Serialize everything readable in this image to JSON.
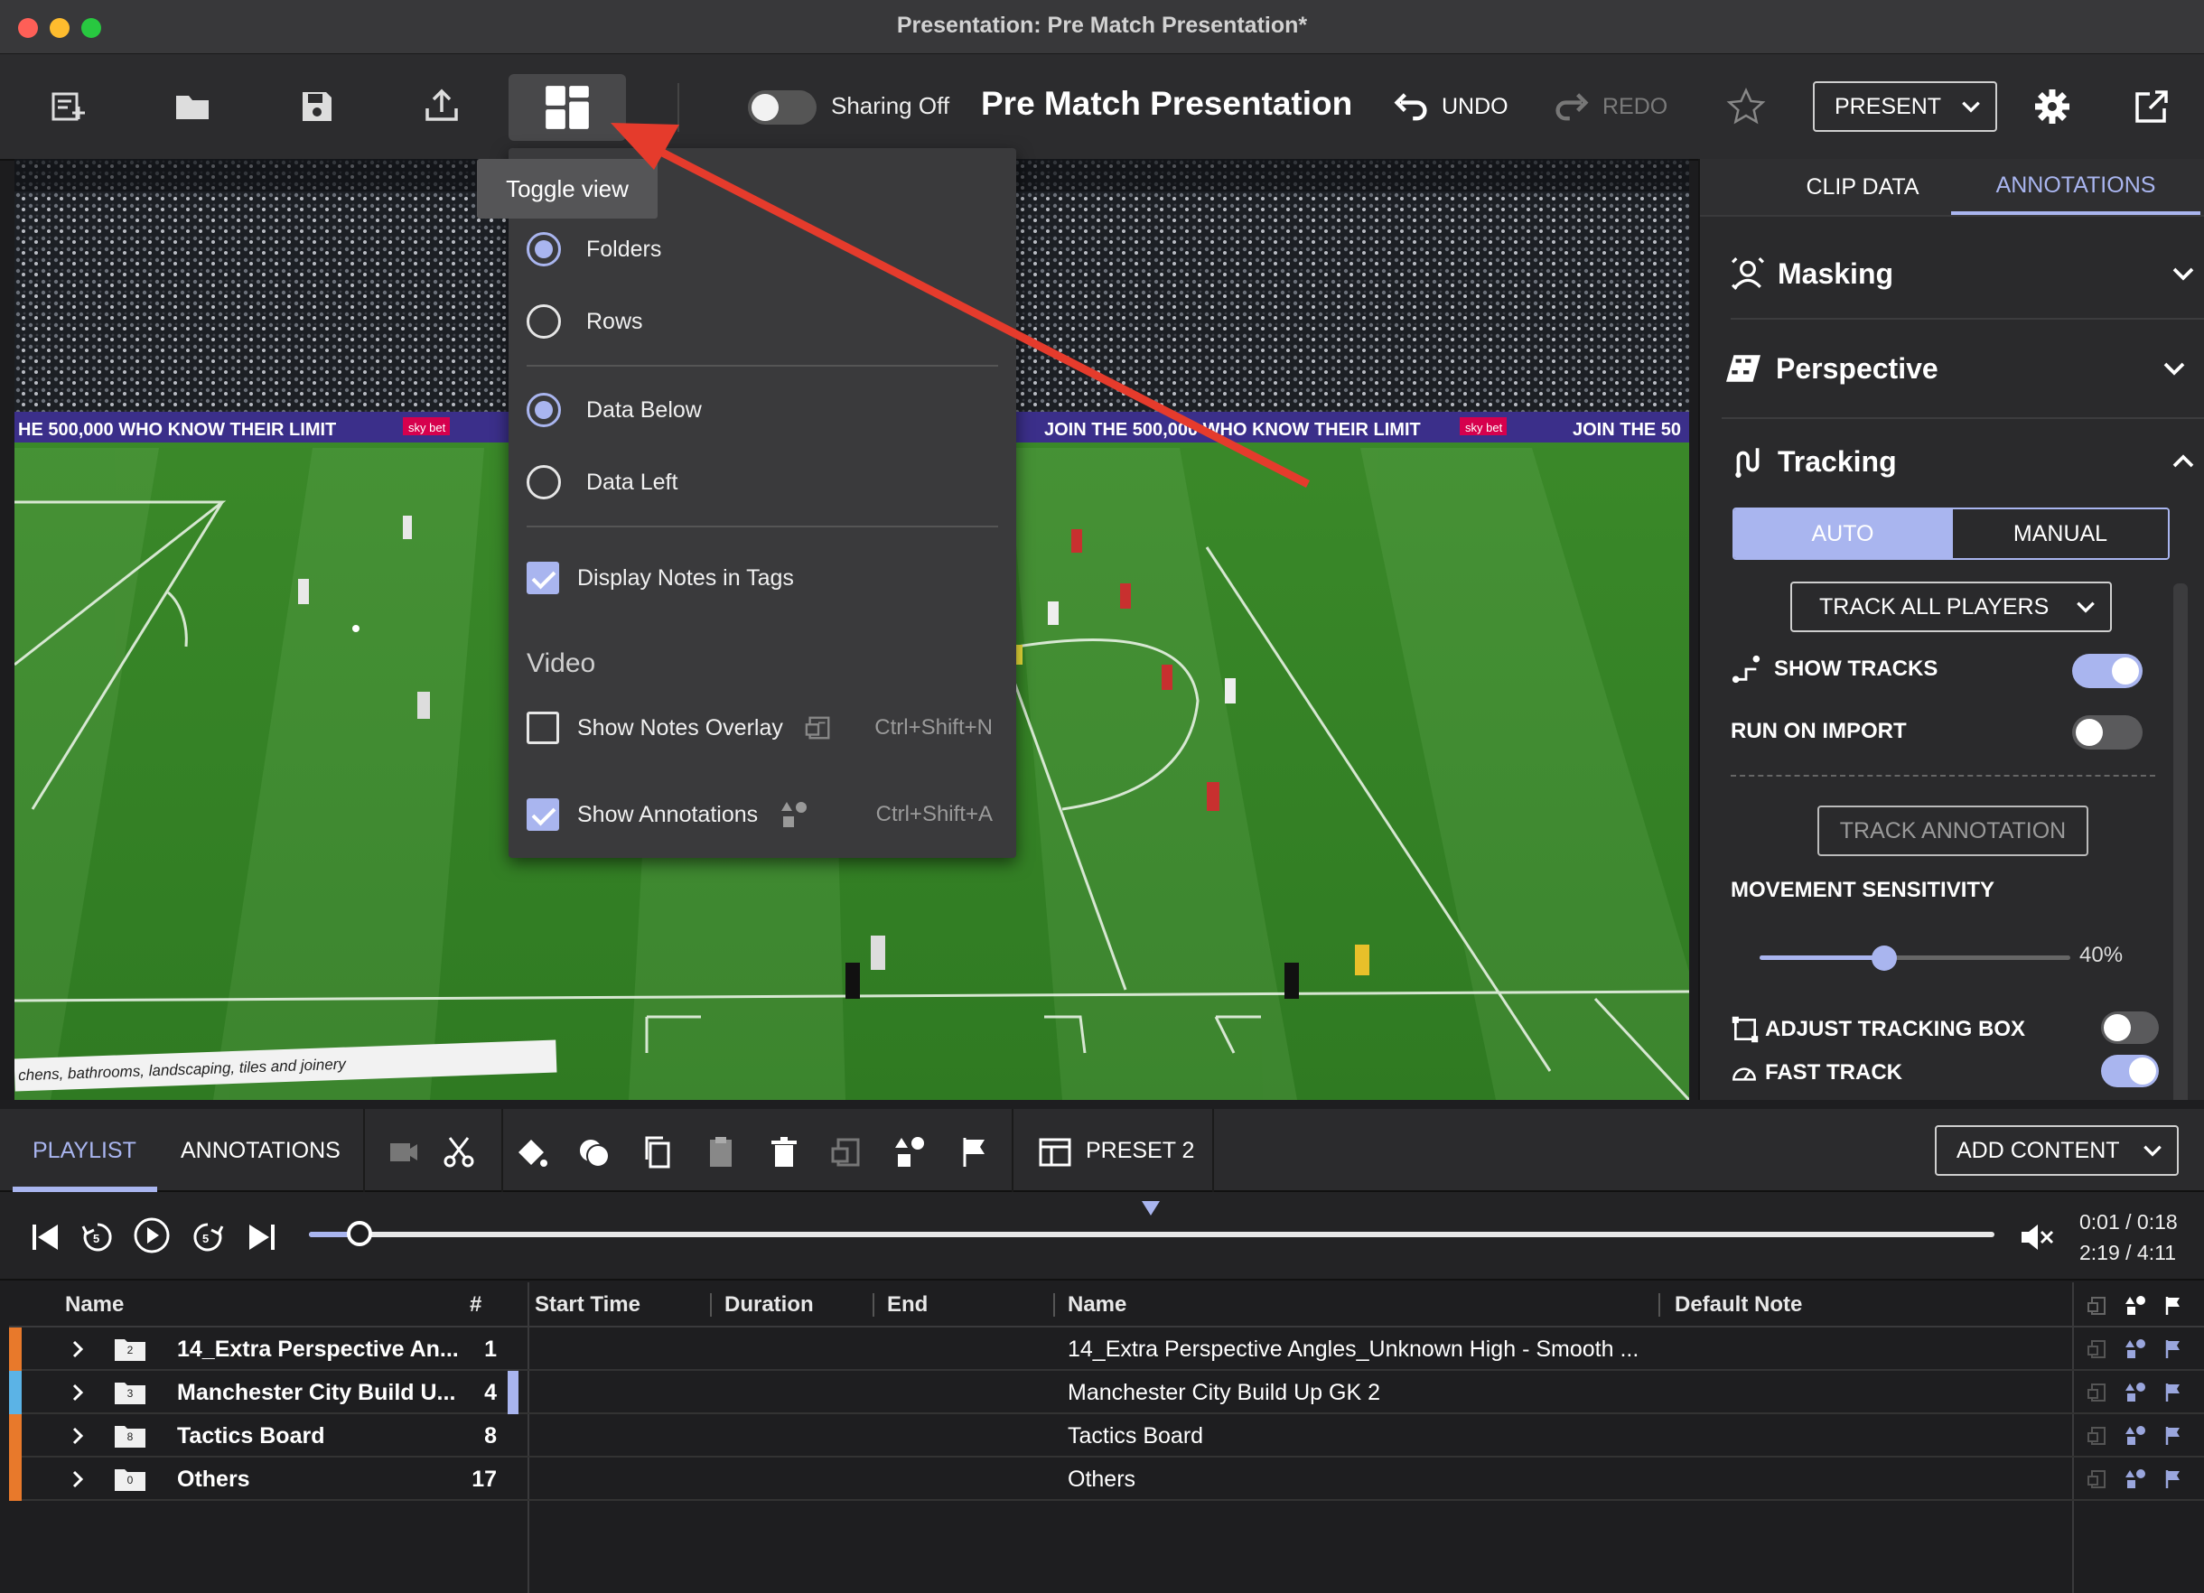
{
  "window": {
    "title": "Presentation: Pre Match Presentation*"
  },
  "toolbar": {
    "sharing_label": "Sharing Off",
    "presentation_title": "Pre Match Presentation",
    "undo_label": "UNDO",
    "redo_label": "REDO",
    "present_label": "PRESENT"
  },
  "tooltip": {
    "text": "Toggle view"
  },
  "view_menu": {
    "folders": "Folders",
    "rows": "Rows",
    "data_below": "Data Below",
    "data_left": "Data Left",
    "display_notes_in_tags": "Display Notes in Tags",
    "video_heading": "Video",
    "show_notes_overlay": "Show Notes Overlay",
    "show_notes_overlay_shortcut": "Ctrl+Shift+N",
    "show_annotations": "Show Annotations",
    "show_annotations_shortcut": "Ctrl+Shift+A",
    "selected_layout": "Folders",
    "selected_data": "Data Below",
    "display_notes_checked": true,
    "show_notes_overlay_checked": false,
    "show_annotations_checked": true
  },
  "video": {
    "banner_left": "HE 500,000 WHO KNOW THEIR LIMIT",
    "banner_right": "JOIN THE 500,000 WHO KNOW THEIR LIMIT",
    "banner_right2": "JOIN THE 50",
    "sponsor": "sky bet",
    "bottom_banner": "chens, bathrooms, landscaping, tiles and joinery"
  },
  "right_panel": {
    "tabs": [
      "CLIP DATA",
      "ANNOTATIONS"
    ],
    "active_tab": "ANNOTATIONS",
    "masking": "Masking",
    "perspective": "Perspective",
    "tracking": "Tracking",
    "mode_auto": "AUTO",
    "mode_manual": "MANUAL",
    "track_select": "TRACK ALL PLAYERS",
    "show_tracks": "SHOW TRACKS",
    "show_tracks_on": true,
    "run_on_import": "RUN ON IMPORT",
    "run_on_import_on": false,
    "track_annotation": "TRACK ANNOTATION",
    "movement_sensitivity": "MOVEMENT SENSITIVITY",
    "sensitivity_value": "40%",
    "sensitivity_fraction": 0.4,
    "adjust_tracking_box": "ADJUST TRACKING BOX",
    "adjust_tracking_box_on": false,
    "fast_track": "FAST TRACK",
    "fast_track_on": true
  },
  "bottom": {
    "tab_playlist": "PLAYLIST",
    "tab_annotations": "ANNOTATIONS",
    "preset": "PRESET 2",
    "add_content": "ADD CONTENT",
    "time_current": "0:01 / 0:18",
    "time_total": "2:19 / 4:11",
    "playhead_fraction": 0.03
  },
  "table": {
    "headers": {
      "name": "Name",
      "count": "#",
      "start_time": "Start Time",
      "duration": "Duration",
      "end": "End",
      "name2": "Name",
      "default_note": "Default Note"
    },
    "rows": [
      {
        "name": "14_Extra Perspective An...",
        "folder_num": "2",
        "count": "1",
        "clip_name": "14_Extra Perspective Angles_Unknown High - Smooth ...",
        "color": "#e8792b"
      },
      {
        "name": "Manchester City Build U...",
        "folder_num": "3",
        "count": "4",
        "clip_name": "Manchester City Build Up GK 2",
        "color": "#5bb3e6"
      },
      {
        "name": "Tactics Board",
        "folder_num": "8",
        "count": "8",
        "clip_name": "Tactics Board",
        "color": "#e8792b"
      },
      {
        "name": "Others",
        "folder_num": "0",
        "count": "17",
        "clip_name": "Others",
        "color": "#e8792b"
      }
    ]
  }
}
